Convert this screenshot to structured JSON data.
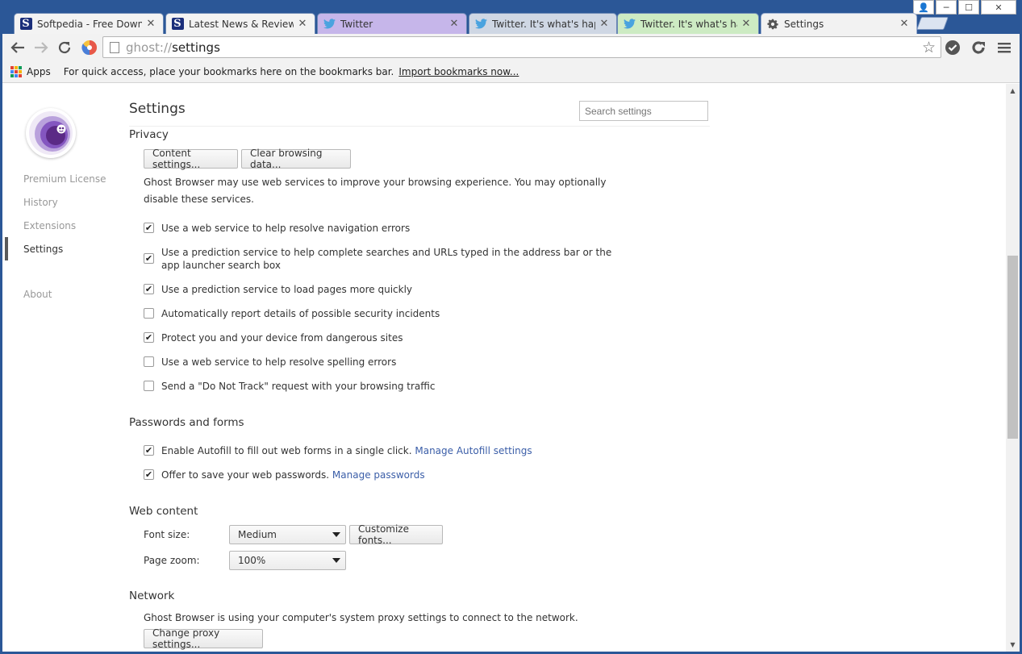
{
  "tabs": [
    {
      "title": "Softpedia - Free Downlo",
      "icon": "softpedia-icon",
      "bg": "#f3f3f3",
      "active": false
    },
    {
      "title": "Latest News & Reviews b",
      "icon": "softpedia-icon",
      "bg": "#f3f3f3",
      "active": false
    },
    {
      "title": "Twitter",
      "icon": "twitter-icon",
      "bg": "#c6b6ea",
      "active": false
    },
    {
      "title": "Twitter. It's what's happe",
      "icon": "twitter-icon",
      "bg": "#cfd7e4",
      "active": false
    },
    {
      "title": "Twitter. It's what's happe",
      "icon": "twitter-icon",
      "bg": "#cdebc3",
      "active": false
    },
    {
      "title": "Settings",
      "icon": "gear-icon",
      "bg": "#f2f2f2",
      "active": true
    }
  ],
  "tab_close_glyph": "✕",
  "window_buttons": {
    "user": "👤",
    "minimize": "─",
    "maximize": "☐",
    "close": "✕"
  },
  "omnibox": {
    "scheme": "ghost://",
    "path": "settings"
  },
  "bookmarks": {
    "apps_label": "Apps",
    "hint": "For quick access, place your bookmarks here on the bookmarks bar.",
    "import_link": "Import bookmarks now..."
  },
  "sidebar": {
    "items": [
      {
        "label": "Premium License",
        "active": false
      },
      {
        "label": "History",
        "active": false
      },
      {
        "label": "Extensions",
        "active": false
      },
      {
        "label": "Settings",
        "active": true
      },
      {
        "label": "About",
        "active": false
      }
    ]
  },
  "settings": {
    "title": "Settings",
    "search_placeholder": "Search settings",
    "privacy": {
      "title": "Privacy",
      "content_settings_button": "Content settings...",
      "clear_data_button": "Clear browsing data...",
      "description": "Ghost Browser may use web services to improve your browsing experience. You may optionally disable these services.",
      "options": [
        {
          "label": "Use a web service to help resolve navigation errors",
          "checked": true
        },
        {
          "label": "Use a prediction service to help complete searches and URLs typed in the address bar or the app launcher search box",
          "checked": true
        },
        {
          "label": "Use a prediction service to load pages more quickly",
          "checked": true
        },
        {
          "label": "Automatically report details of possible security incidents",
          "checked": false
        },
        {
          "label": "Protect you and your device from dangerous sites",
          "checked": true
        },
        {
          "label": "Use a web service to help resolve spelling errors",
          "checked": false
        },
        {
          "label": "Send a \"Do Not Track\" request with your browsing traffic",
          "checked": false
        }
      ]
    },
    "passwords": {
      "title": "Passwords and forms",
      "autofill_label": "Enable Autofill to fill out web forms in a single click.",
      "autofill_link": "Manage Autofill settings",
      "autofill_checked": true,
      "save_label": "Offer to save your web passwords.",
      "save_link": "Manage passwords",
      "save_checked": true
    },
    "web_content": {
      "title": "Web content",
      "font_size_label": "Font size:",
      "font_size_value": "Medium",
      "customize_fonts_button": "Customize fonts...",
      "page_zoom_label": "Page zoom:",
      "page_zoom_value": "100%"
    },
    "network": {
      "title": "Network",
      "description": "Ghost Browser is using your computer's system proxy settings to connect to the network.",
      "proxy_button": "Change proxy settings..."
    }
  },
  "check_glyph": "✔",
  "colors": {
    "frame": "#2b5797",
    "link": "#3b5ea8",
    "ghost_purple": "#5b2a86"
  }
}
